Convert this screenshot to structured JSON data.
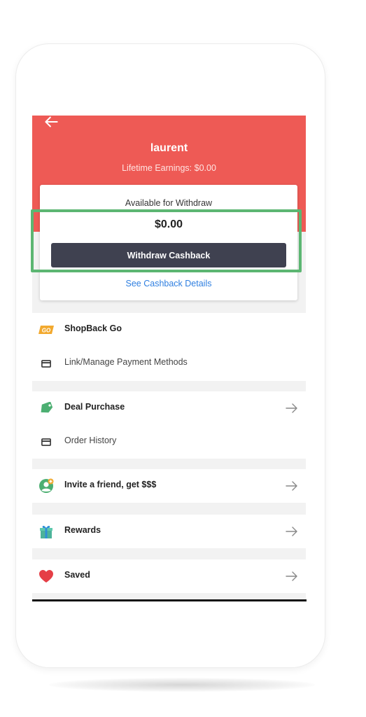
{
  "profile": {
    "username": "laurent",
    "lifetime_earnings": "Lifetime Earnings: $0.00"
  },
  "withdraw_card": {
    "label": "Available for Withdraw",
    "amount": "$0.00",
    "button_label": "Withdraw Cashback",
    "details_link": "See Cashback Details"
  },
  "menu": {
    "shopback_go": {
      "icon_text": "GO",
      "label": "ShopBack Go"
    },
    "link_payment": {
      "label": "Link/Manage Payment Methods"
    },
    "deal_purchase": {
      "label": "Deal Purchase"
    },
    "order_history": {
      "label": "Order History"
    },
    "invite_friend": {
      "label": "Invite a friend, get $$$"
    },
    "rewards": {
      "label": "Rewards"
    },
    "saved": {
      "label": "Saved"
    }
  },
  "colors": {
    "header_red": "#ee5a55",
    "button_dark": "#3f4150",
    "link_blue": "#2f7fe0",
    "highlight_green": "#5cb672"
  }
}
